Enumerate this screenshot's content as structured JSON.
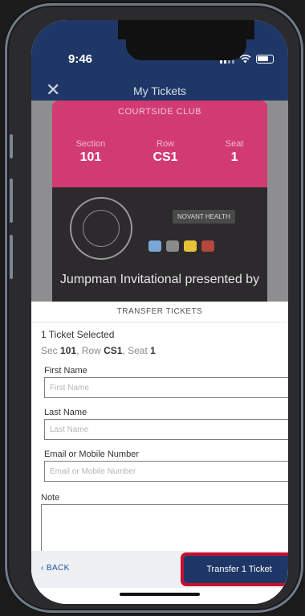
{
  "status_bar": {
    "time": "9:46"
  },
  "header": {
    "title": "My Tickets",
    "close_icon": "close-icon"
  },
  "ticket": {
    "section_name": "COURTSIDE CLUB",
    "section_label": "Section",
    "section_value": "101",
    "row_label": "Row",
    "row_value": "CS1",
    "seat_label": "Seat",
    "seat_value": "1",
    "event_name": "Jumpman Invitational presented by",
    "sponsor": "NOVANT HEALTH",
    "colors": {
      "card": "#d23a73",
      "header": "#1f3766"
    }
  },
  "transfer": {
    "title": "TRANSFER TICKETS",
    "selected_count": "1 Ticket Selected",
    "sec_label": "Sec",
    "sec_value": "101",
    "row_label": ", Row",
    "row_value": "CS1",
    "seat_label": ", Seat",
    "seat_value": "1",
    "first_name_label": "First Name",
    "first_name_placeholder": "First Name",
    "last_name_label": "Last Name",
    "last_name_placeholder": "Last Name",
    "contact_label": "Email or Mobile Number",
    "contact_placeholder": "Email or Mobile Number",
    "note_label": "Note",
    "back_label": "BACK",
    "submit_label": "Transfer 1 Ticket",
    "highlight_color": "#c8102e"
  }
}
